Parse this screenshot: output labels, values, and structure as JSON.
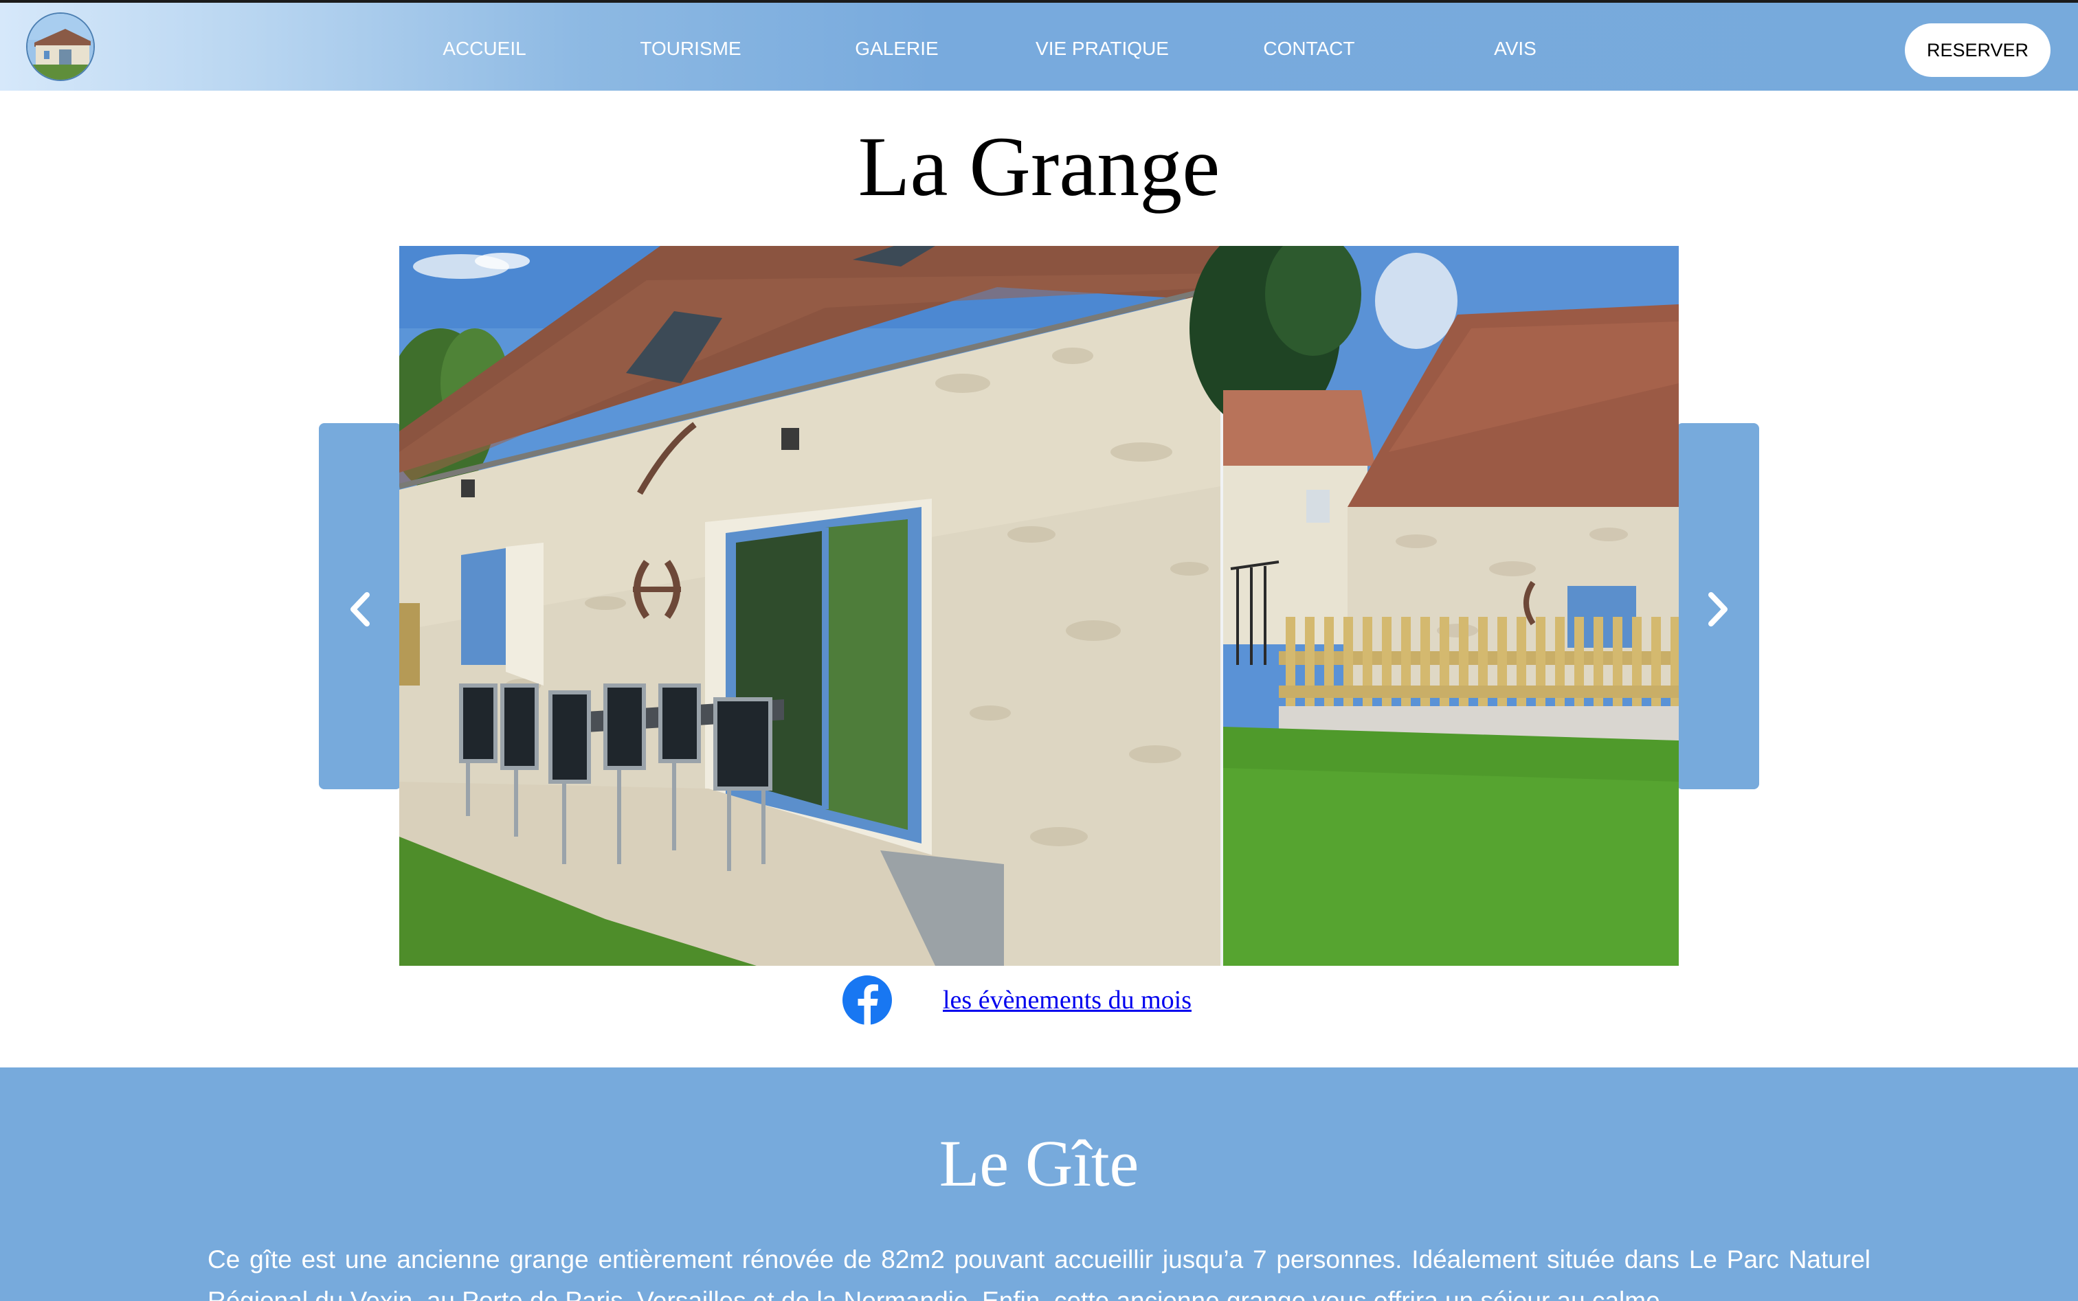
{
  "nav": {
    "logo_alt": "La Grange logo",
    "items": [
      {
        "label": "ACCUEIL"
      },
      {
        "label": "TOURISME"
      },
      {
        "label": "GALERIE"
      },
      {
        "label": "VIE PRATIQUE"
      },
      {
        "label": "CONTACT"
      },
      {
        "label": "AVIS"
      }
    ],
    "reserve_label": "RESERVER"
  },
  "hero": {
    "title": "La Grange"
  },
  "carousel": {
    "prev_icon": "chevron-left-icon",
    "next_icon": "chevron-right-icon",
    "slides": [
      {
        "description": "stone-barn-terrace-photo"
      },
      {
        "description": "barn-garden-fence-photo"
      }
    ]
  },
  "social": {
    "facebook_icon": "facebook-icon",
    "events_link": "les évènements du mois"
  },
  "gite": {
    "title": "Le Gîte",
    "text": "Ce gîte est une ancienne grange entièrement rénovée de 82m2 pouvant accueillir jusqu’a 7 personnes. Idéalement située dans Le Parc Naturel Régional du Vexin, au Porte de Paris, Versailles et de la Normandie. Enfin, cette ancienne grange vous offrira un séjour au calme."
  },
  "colors": {
    "nav_blue": "#77aadc",
    "section_blue": "#77aadc",
    "link": "#0000ee",
    "facebook": "#1877f2"
  }
}
